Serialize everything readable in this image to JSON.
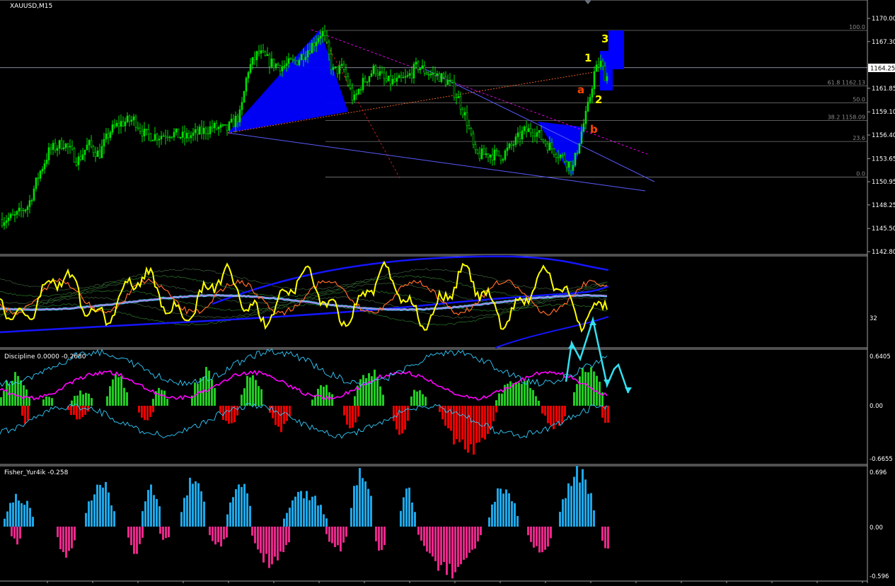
{
  "window_title": "XAUUSD,M15",
  "colors": {
    "background": "#000000",
    "separator": "#a0a0a0",
    "bull_candle": "#00e000",
    "fill_blue": "#0000ff",
    "yellow": "#ffff00",
    "orange_red": "#ff4500",
    "cyan": "#33ccff",
    "magenta": "#ff00ff",
    "red_hist": "#ee0000",
    "green_hist": "#22cc22",
    "sky_hist": "#1ea7e8",
    "pink_hist": "#e8288a"
  },
  "current_price": "1164.25",
  "wave_labels": {
    "w1": "1",
    "w2": "2",
    "w3": "3",
    "a": "a",
    "b": "b"
  },
  "fib_levels": [
    {
      "level": "100.0",
      "price": 1168.6
    },
    {
      "level": "61.8 1162.13",
      "price": 1162.13
    },
    {
      "level": "50.0",
      "price": 1160.15
    },
    {
      "level": "38.2 1158.09",
      "price": 1158.09
    },
    {
      "level": "23.6",
      "price": 1155.65
    },
    {
      "level": "0.0",
      "price": 1151.5
    }
  ],
  "panes": {
    "indicator1": {
      "label": "",
      "axis_tick": "32"
    },
    "discipline": {
      "label": "Discipline 0.0000 -0.2680",
      "ticks": [
        "0.6405",
        "0.00",
        "-0.6655"
      ]
    },
    "fisher": {
      "label": "Fisher_Yur4ik -0.258",
      "ticks": [
        "0.696",
        "0.00",
        "-0.596"
      ]
    }
  },
  "chart_data": [
    {
      "type": "candlestick",
      "title": "XAUUSD,M15",
      "ylim": [
        1142.8,
        1170.0
      ],
      "y_ticks": [
        "1170.00",
        "1167.30",
        "1161.85",
        "1159.10",
        "1156.40",
        "1153.65",
        "1150.95",
        "1148.25",
        "1145.50",
        "1142.80"
      ],
      "close_path": [
        [
          0,
          1146.5
        ],
        [
          20,
          1146.8
        ],
        [
          40,
          1148.2
        ],
        [
          55,
          1151.8
        ],
        [
          70,
          1154.6
        ],
        [
          90,
          1155.5
        ],
        [
          110,
          1153.4
        ],
        [
          125,
          1155.3
        ],
        [
          140,
          1154.1
        ],
        [
          155,
          1156.8
        ],
        [
          170,
          1157.8
        ],
        [
          190,
          1158.2
        ],
        [
          205,
          1156.4
        ],
        [
          225,
          1156.3
        ],
        [
          240,
          1156.7
        ],
        [
          260,
          1156.1
        ],
        [
          280,
          1156.6
        ],
        [
          300,
          1157.3
        ],
        [
          320,
          1157.0
        ],
        [
          340,
          1158.8
        ],
        [
          350,
          1163.9
        ],
        [
          365,
          1166.0
        ],
        [
          385,
          1164.7
        ],
        [
          400,
          1164.4
        ],
        [
          420,
          1165.1
        ],
        [
          440,
          1166.8
        ],
        [
          455,
          1168.5
        ],
        [
          460,
          1167.3
        ],
        [
          470,
          1163.8
        ],
        [
          485,
          1164.2
        ],
        [
          500,
          1160.3
        ],
        [
          510,
          1162.2
        ],
        [
          530,
          1164.2
        ],
        [
          545,
          1162.6
        ],
        [
          560,
          1162.6
        ],
        [
          575,
          1163.0
        ],
        [
          590,
          1164.5
        ],
        [
          605,
          1163.6
        ],
        [
          620,
          1163.3
        ],
        [
          635,
          1162.5
        ],
        [
          648,
          1160.6
        ],
        [
          660,
          1158.0
        ],
        [
          672,
          1154.0
        ],
        [
          690,
          1154.2
        ],
        [
          710,
          1154.0
        ],
        [
          725,
          1155.3
        ],
        [
          740,
          1156.8
        ],
        [
          755,
          1157.0
        ],
        [
          770,
          1155.6
        ],
        [
          785,
          1154.5
        ],
        [
          800,
          1153.4
        ],
        [
          810,
          1152.6
        ],
        [
          820,
          1156.2
        ],
        [
          830,
          1159.2
        ],
        [
          840,
          1163.6
        ],
        [
          848,
          1164.9
        ],
        [
          856,
          1163.2
        ]
      ]
    },
    {
      "type": "line",
      "title": "",
      "axis_tick": "32"
    },
    {
      "type": "bar",
      "title": "Discipline 0.0000 -0.2680",
      "ylim": [
        -0.6655,
        0.6405
      ],
      "positive_groups": [
        [
          0,
          40,
          0.38
        ],
        [
          60,
          75,
          0.14
        ],
        [
          100,
          130,
          0.18
        ],
        [
          150,
          180,
          0.36
        ],
        [
          215,
          235,
          0.22
        ],
        [
          270,
          305,
          0.44
        ],
        [
          340,
          370,
          0.4
        ],
        [
          440,
          470,
          0.26
        ],
        [
          500,
          540,
          0.46
        ],
        [
          580,
          600,
          0.22
        ],
        [
          700,
          760,
          0.34
        ],
        [
          810,
          850,
          0.5
        ]
      ],
      "negative_groups": [
        [
          30,
          40,
          -0.2
        ],
        [
          95,
          125,
          -0.16
        ],
        [
          195,
          215,
          -0.18
        ],
        [
          310,
          335,
          -0.26
        ],
        [
          380,
          410,
          -0.3
        ],
        [
          485,
          505,
          -0.28
        ],
        [
          555,
          575,
          -0.4
        ],
        [
          620,
          700,
          -0.56
        ],
        [
          765,
          800,
          -0.26
        ],
        [
          850,
          860,
          -0.24
        ]
      ]
    },
    {
      "type": "bar",
      "title": "Fisher_Yur4ik -0.258",
      "ylim": [
        -0.596,
        0.696
      ],
      "positive_groups": [
        [
          5,
          45,
          0.38
        ],
        [
          120,
          160,
          0.56
        ],
        [
          200,
          225,
          0.48
        ],
        [
          255,
          290,
          0.58
        ],
        [
          320,
          355,
          0.52
        ],
        [
          400,
          460,
          0.42
        ],
        [
          495,
          525,
          0.7
        ],
        [
          565,
          585,
          0.46
        ],
        [
          690,
          730,
          0.48
        ],
        [
          790,
          840,
          0.7
        ]
      ],
      "negative_groups": [
        [
          15,
          30,
          -0.2
        ],
        [
          80,
          105,
          -0.36
        ],
        [
          180,
          200,
          -0.3
        ],
        [
          225,
          240,
          -0.16
        ],
        [
          295,
          320,
          -0.24
        ],
        [
          355,
          410,
          -0.44
        ],
        [
          460,
          490,
          -0.28
        ],
        [
          530,
          545,
          -0.3
        ],
        [
          590,
          680,
          -0.56
        ],
        [
          745,
          780,
          -0.32
        ],
        [
          850,
          860,
          -0.3
        ]
      ]
    }
  ]
}
